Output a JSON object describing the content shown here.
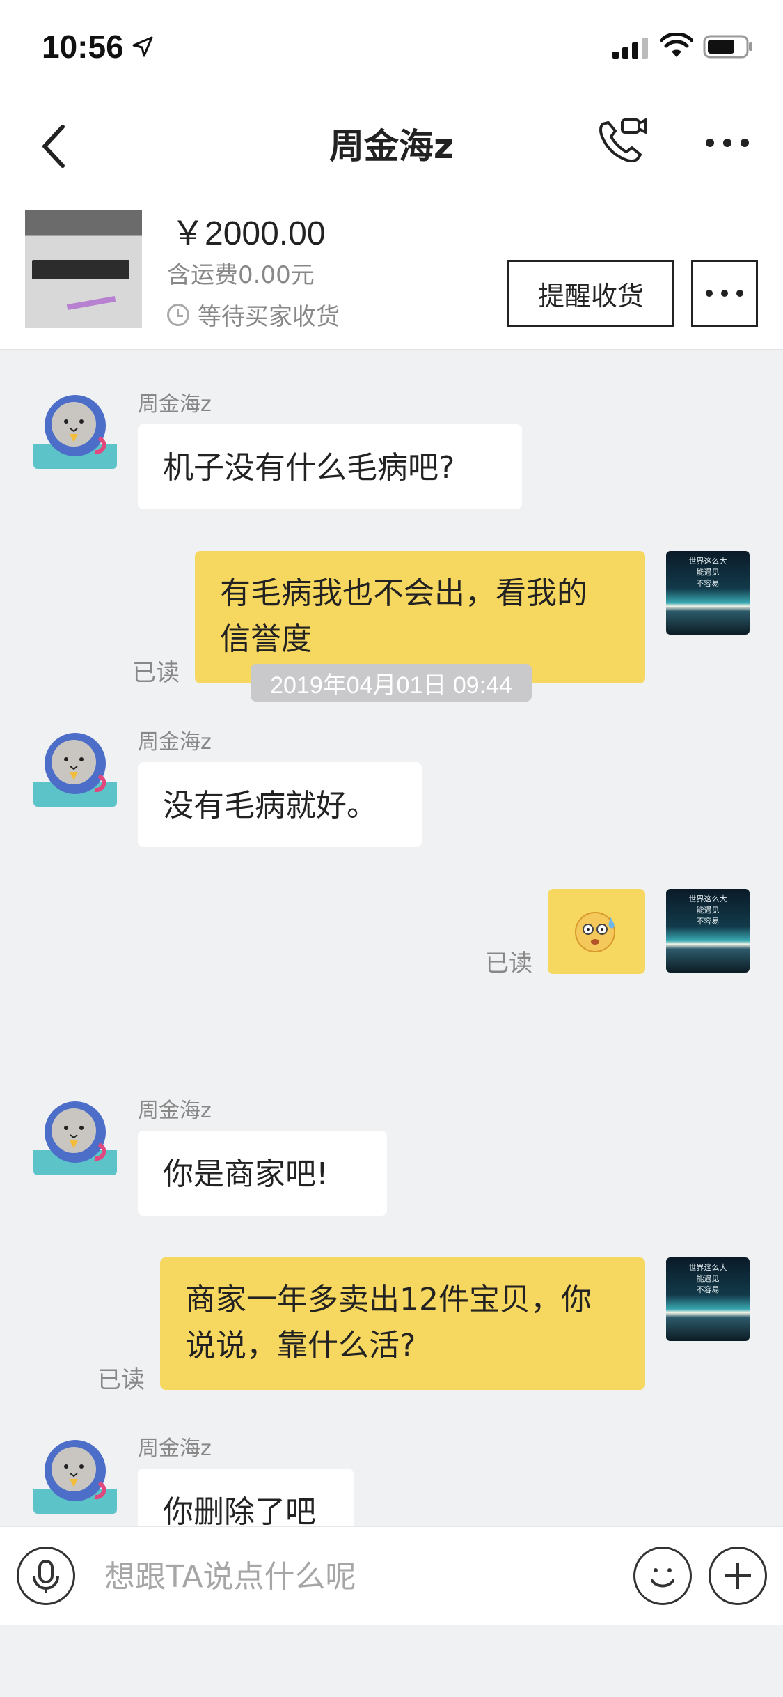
{
  "status_bar": {
    "time": "10:56"
  },
  "nav": {
    "title": "周金海z"
  },
  "item": {
    "price": "￥2000.00",
    "shipping": "含运费0.00元",
    "status": "等待买家收货",
    "remind_label": "提醒收货"
  },
  "messages": [
    {
      "direction": "in",
      "sender": "周金海z",
      "text": "机子没有什么毛病吧?"
    },
    {
      "direction": "out",
      "read": "已读",
      "lines": [
        "有毛病我也不会出，看我的",
        "信誉度"
      ]
    },
    {
      "direction": "in",
      "sender": "周金海z",
      "text": "没有毛病就好。"
    },
    {
      "direction": "out",
      "read": "已读",
      "type": "emoji",
      "emoji": "sweat-smile-emoji"
    },
    {
      "direction": "in",
      "sender": "周金海z",
      "text": "你是商家吧!"
    },
    {
      "direction": "out",
      "read": "已读",
      "lines": [
        "商家一年多卖出12件宝贝，你",
        "说说，靠什么活?"
      ]
    },
    {
      "direction": "in",
      "sender": "周金海z",
      "text": "你删除了吧"
    }
  ],
  "timestamp": "2019年04月01日  09:44",
  "self_avatar_lines": [
    "世界这么大",
    "能遇见",
    "不容易"
  ],
  "input": {
    "placeholder": "想跟TA说点什么呢"
  },
  "colors": {
    "bubble_out": "#f6d760",
    "bubble_in": "#ffffff",
    "background": "#f0f1f3"
  }
}
